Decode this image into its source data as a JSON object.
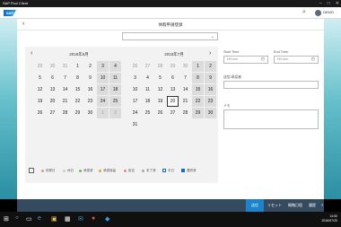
{
  "os": {
    "window_title": "SAP Fiori Client",
    "time": "14:50",
    "date": "2016/07/20"
  },
  "shell": {
    "logo": "SAP",
    "user": "DEMO"
  },
  "page": {
    "title": "休暇申請登録",
    "select_value": ""
  },
  "calendar": {
    "months": [
      {
        "title": "2016年6月",
        "days": [
          {
            "d": "29",
            "o": true,
            "w": false
          },
          {
            "d": "30",
            "o": true,
            "w": false
          },
          {
            "d": "31",
            "o": true,
            "w": false
          },
          {
            "d": "1",
            "o": false,
            "w": false
          },
          {
            "d": "2",
            "o": false,
            "w": false
          },
          {
            "d": "3",
            "o": false,
            "w": true
          },
          {
            "d": "4",
            "o": false,
            "w": true
          },
          {
            "d": "5",
            "o": false,
            "w": false
          },
          {
            "d": "6",
            "o": false,
            "w": false
          },
          {
            "d": "7",
            "o": false,
            "w": false
          },
          {
            "d": "8",
            "o": false,
            "w": false
          },
          {
            "d": "9",
            "o": false,
            "w": false
          },
          {
            "d": "10",
            "o": false,
            "w": true
          },
          {
            "d": "11",
            "o": false,
            "w": true
          },
          {
            "d": "12",
            "o": false,
            "w": false
          },
          {
            "d": "13",
            "o": false,
            "w": false
          },
          {
            "d": "14",
            "o": false,
            "w": false
          },
          {
            "d": "15",
            "o": false,
            "w": false
          },
          {
            "d": "16",
            "o": false,
            "w": false
          },
          {
            "d": "17",
            "o": false,
            "w": true
          },
          {
            "d": "18",
            "o": false,
            "w": true
          },
          {
            "d": "19",
            "o": false,
            "w": false
          },
          {
            "d": "20",
            "o": false,
            "w": false
          },
          {
            "d": "21",
            "o": false,
            "w": false
          },
          {
            "d": "22",
            "o": false,
            "w": false
          },
          {
            "d": "23",
            "o": false,
            "w": false
          },
          {
            "d": "24",
            "o": false,
            "w": true
          },
          {
            "d": "25",
            "o": false,
            "w": true
          },
          {
            "d": "26",
            "o": false,
            "w": false
          },
          {
            "d": "27",
            "o": false,
            "w": false
          },
          {
            "d": "28",
            "o": false,
            "w": false
          },
          {
            "d": "29",
            "o": false,
            "w": false
          },
          {
            "d": "30",
            "o": false,
            "w": false
          },
          {
            "d": "1",
            "o": true,
            "w": true
          },
          {
            "d": "2",
            "o": true,
            "w": true
          }
        ]
      },
      {
        "title": "2016年7月",
        "days": [
          {
            "d": "26",
            "o": true,
            "w": false
          },
          {
            "d": "27",
            "o": true,
            "w": false
          },
          {
            "d": "28",
            "o": true,
            "w": false
          },
          {
            "d": "29",
            "o": true,
            "w": false
          },
          {
            "d": "30",
            "o": true,
            "w": false
          },
          {
            "d": "1",
            "o": false,
            "w": true
          },
          {
            "d": "2",
            "o": false,
            "w": true
          },
          {
            "d": "3",
            "o": false,
            "w": false
          },
          {
            "d": "4",
            "o": false,
            "w": false
          },
          {
            "d": "5",
            "o": false,
            "w": false
          },
          {
            "d": "6",
            "o": false,
            "w": false
          },
          {
            "d": "7",
            "o": false,
            "w": false
          },
          {
            "d": "8",
            "o": false,
            "w": true
          },
          {
            "d": "9",
            "o": false,
            "w": true
          },
          {
            "d": "10",
            "o": false,
            "w": false
          },
          {
            "d": "11",
            "o": false,
            "w": false
          },
          {
            "d": "12",
            "o": false,
            "w": false
          },
          {
            "d": "13",
            "o": false,
            "w": false
          },
          {
            "d": "14",
            "o": false,
            "w": false
          },
          {
            "d": "15",
            "o": false,
            "w": true
          },
          {
            "d": "16",
            "o": false,
            "w": true
          },
          {
            "d": "17",
            "o": false,
            "w": false
          },
          {
            "d": "18",
            "o": false,
            "w": false
          },
          {
            "d": "19",
            "o": false,
            "w": false
          },
          {
            "d": "20",
            "o": false,
            "w": false,
            "t": true
          },
          {
            "d": "21",
            "o": false,
            "w": false
          },
          {
            "d": "22",
            "o": false,
            "w": true
          },
          {
            "d": "23",
            "o": false,
            "w": true
          },
          {
            "d": "24",
            "o": false,
            "w": false
          },
          {
            "d": "25",
            "o": false,
            "w": false
          },
          {
            "d": "26",
            "o": false,
            "w": false
          },
          {
            "d": "27",
            "o": false,
            "w": false
          },
          {
            "d": "28",
            "o": false,
            "w": false
          },
          {
            "d": "29",
            "o": false,
            "w": true
          },
          {
            "d": "30",
            "o": false,
            "w": true
          },
          {
            "d": "31",
            "o": false,
            "w": false
          }
        ]
      }
    ]
  },
  "legend": [
    "祝祭日",
    "休日",
    "承認済",
    "承認保留",
    "拒否",
    "未了済",
    "半日",
    "選択済"
  ],
  "form": {
    "start_time_label": "Start Time",
    "start_time_placeholder": "HH:mm",
    "end_time_label": "End Time",
    "end_time_placeholder": "HH:mm",
    "manager_label": "送信/承認者",
    "note_label": "メモ"
  },
  "toolbar": {
    "buttons": [
      "送信",
      "リセット",
      "概略日程",
      "履歴"
    ]
  }
}
